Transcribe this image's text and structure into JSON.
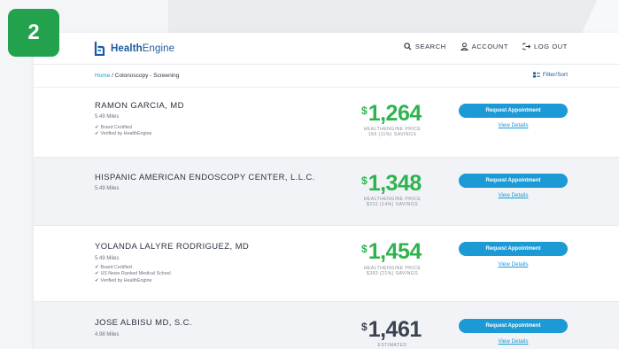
{
  "step_badge": "2",
  "header": {
    "logo": {
      "brand_bold": "Health",
      "brand_light": "Engine"
    },
    "nav": {
      "search": "SEARCH",
      "account": "ACCOUNT",
      "logout": "LOG OUT"
    }
  },
  "breadcrumb": {
    "home": "Home",
    "separator": " / ",
    "current": "Colonoscopy - Screening"
  },
  "filter_label": "Filter/Sort",
  "results": [
    {
      "name": "RAMON GARCIA, MD",
      "miles": "5.49 Miles",
      "badges": [
        "Board Certified",
        "Verified by HealthEngine"
      ],
      "price": "1,264",
      "price_label": "HEALTHENGINE PRICE",
      "savings": "166 (11%) SAVINGS",
      "button": "Request Appointment",
      "details": "View Details"
    },
    {
      "name": "HISPANIC AMERICAN ENDOSCOPY CENTER, L.L.C.",
      "miles": "5.49 Miles",
      "badges": [],
      "price": "1,348",
      "price_label": "HEALTHENGINE PRICE",
      "savings": "$222 (14%) SAVINGS",
      "button": "Request Appointment",
      "details": "View Details"
    },
    {
      "name": "YOLANDA LALYRE RODRIGUEZ, MD",
      "miles": "5.49 Miles",
      "badges": [
        "Board Certified",
        "US News Ranked Medical School",
        "Verified by HealthEngine"
      ],
      "price": "1,454",
      "price_label": "HEALTHENGINE PRICE",
      "savings": "$383 (21%) SAVINGS",
      "button": "Request Appointment",
      "details": "View Details"
    },
    {
      "name": "JOSE ALBISU MD, S.C.",
      "miles": "4.98 Miles",
      "badges": [],
      "price": "1,461",
      "price_label": "ESTIMATED",
      "savings": "",
      "button": "Request Appointment",
      "details": "View Details"
    }
  ],
  "colors": {
    "accent": "#1b9ad6",
    "price_green": "#2db44e",
    "badge_green": "#23a24d",
    "brand_blue": "#1f5a9c"
  }
}
